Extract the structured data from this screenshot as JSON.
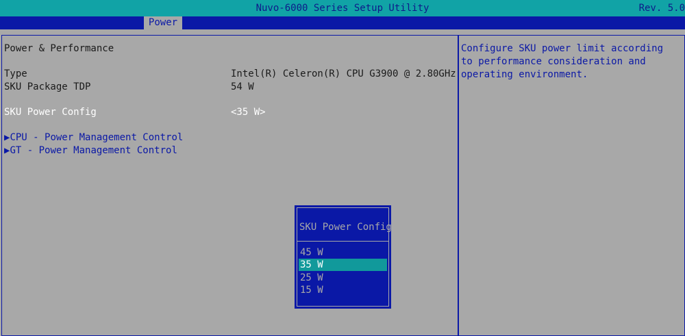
{
  "header": {
    "title": "Nuvo-6000 Series Setup Utility",
    "rev": "Rev. 5.0"
  },
  "tabs": [
    {
      "label": "Power",
      "active": true
    }
  ],
  "main": {
    "section_title": "Power & Performance",
    "type_label": "Type",
    "type_value": "Intel(R) Celeron(R) CPU G3900 @ 2.80GHz",
    "tdp_label": "SKU Package TDP",
    "tdp_value": "54 W",
    "power_config_label": "SKU Power Config",
    "power_config_value": "<35 W>",
    "submenus": [
      "CPU - Power Management Control",
      "GT - Power Management Control"
    ],
    "submenu_icon": "triangle-right-icon"
  },
  "help": {
    "text": "Configure SKU power limit according to performance consideration and operating environment."
  },
  "popup": {
    "title": "SKU Power Config",
    "options": [
      "45 W",
      "35 W",
      "25 W",
      "15 W"
    ],
    "selected_index": 1
  },
  "colors": {
    "background": "#a8a8a8",
    "title_bar": "#11a3a6",
    "bios_blue": "#0a18a6",
    "selection": "#11999b"
  }
}
